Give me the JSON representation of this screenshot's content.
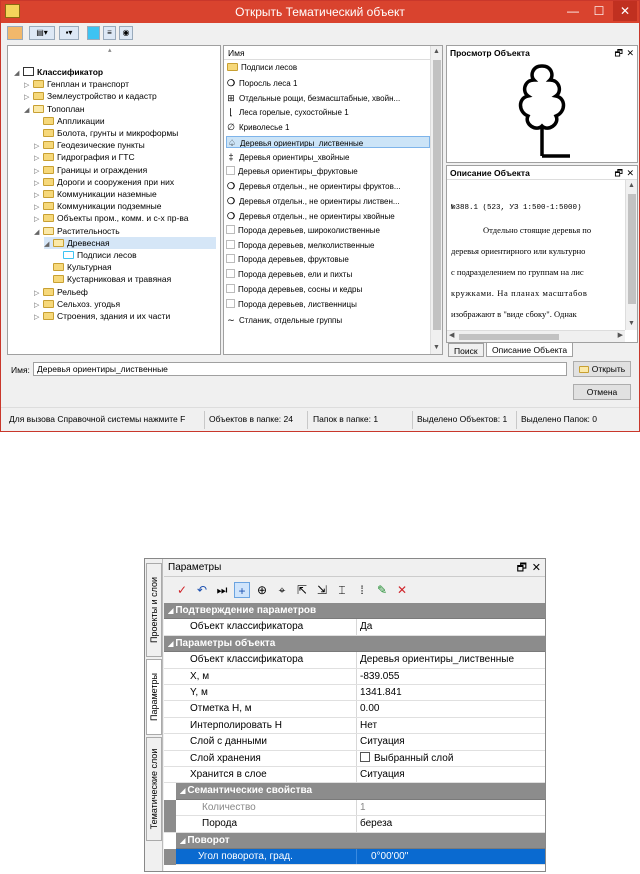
{
  "window": {
    "title": "Открыть Тематический объект",
    "controls": {
      "minimize": "—",
      "maximize": "☐",
      "close": "✕"
    }
  },
  "tree": {
    "items": [
      {
        "label": "Классификатор",
        "level": 0,
        "bold": true
      },
      {
        "label": "Генплан и транспорт",
        "level": 1
      },
      {
        "label": "Землеустройство и кадастр",
        "level": 1
      },
      {
        "label": "Топоплан",
        "level": 1
      },
      {
        "label": "Аппликации",
        "level": 2
      },
      {
        "label": "Болота, грунты и микроформы",
        "level": 2
      },
      {
        "label": "Геодезические пункты",
        "level": 2
      },
      {
        "label": "Гидрография и ГТС",
        "level": 2
      },
      {
        "label": "Границы и ограждения",
        "level": 2
      },
      {
        "label": "Дороги и сооружения при них",
        "level": 2
      },
      {
        "label": "Коммуникации наземные",
        "level": 2
      },
      {
        "label": "Коммуникации подземные",
        "level": 2
      },
      {
        "label": "Объекты пром., комм. и с-х пр-ва",
        "level": 2
      },
      {
        "label": "Растительность",
        "level": 2
      },
      {
        "label": "Древесная",
        "level": 3,
        "selected": true
      },
      {
        "label": "Подписи лесов",
        "level": 4
      },
      {
        "label": "Культурная",
        "level": 3
      },
      {
        "label": "Кустарниковая и травяная",
        "level": 3
      },
      {
        "label": "Рельеф",
        "level": 2
      },
      {
        "label": "Сельхоз. угодья",
        "level": 2
      },
      {
        "label": "Строения, здания и их части",
        "level": 2
      }
    ]
  },
  "list": {
    "header": "Имя",
    "items": [
      {
        "label": "Подписи лесов",
        "icon": "folder-icon"
      },
      {
        "label": "Поросль леса 1",
        "icon": "o"
      },
      {
        "label": "Отдельные рощи, безмасштабные, хвойн...",
        "icon": "tree-grid"
      },
      {
        "label": "Леса горелые, сухостойные 1",
        "icon": "burn"
      },
      {
        "label": "Криволесье 1",
        "icon": "crooked"
      },
      {
        "label": "Деревья ориентиры_лиственные",
        "icon": "tree",
        "selected": true
      },
      {
        "label": "Деревья ориентиры_хвойные",
        "icon": "conifer"
      },
      {
        "label": "Деревья ориентиры_фруктовые",
        "icon": "blank"
      },
      {
        "label": "Деревья отдельн., не ориентиры фруктов...",
        "icon": "o"
      },
      {
        "label": "Деревья отдельн., не ориентиры листвен...",
        "icon": "o"
      },
      {
        "label": "Деревья отдельн., не ориентиры хвойные",
        "icon": "o"
      },
      {
        "label": "Порода деревьев, широколиственные",
        "icon": "blank"
      },
      {
        "label": "Порода деревьев, мелколиственные",
        "icon": "blank"
      },
      {
        "label": "Порода деревьев, фруктовые",
        "icon": "blank"
      },
      {
        "label": "Порода деревьев, ели и пихты",
        "icon": "blank"
      },
      {
        "label": "Порода деревьев, сосны и кедры",
        "icon": "blank"
      },
      {
        "label": "Порода деревьев, лиственницы",
        "icon": "blank"
      },
      {
        "label": "Стланик, отдельные группы",
        "icon": "wave"
      }
    ]
  },
  "preview": {
    "title": "Просмотр Объекта"
  },
  "description": {
    "title": "Описание Объекта",
    "lines": [
      "№388.1 (523, УЗ 1:500-1:5000)",
      "Отдельно стоящие деревья по",
      "деревья ориентирного или культурно",
      "с подразделением по группам на лис",
      "кружками. На планах масштабов",
      "изображают в \"виде сбоку\". Однак"
    ]
  },
  "tabs": {
    "search": "Поиск",
    "description": "Описание Объекта"
  },
  "name_field": {
    "label": "Имя:",
    "value": "Деревья ориентиры_лиственные"
  },
  "buttons": {
    "open": "Открыть",
    "cancel": "Отмена"
  },
  "status": {
    "help": "Для вызова Справочной системы нажмите F",
    "objects": "Объектов в папке: 24",
    "folders": "Папок в папке: 1",
    "sel_objects": "Выделено Объектов: 1",
    "sel_folders": "Выделено Папок: 0"
  },
  "params": {
    "title": "Параметры",
    "vtabs": [
      "Проекты и слои",
      "Параметры",
      "Тематические слои"
    ],
    "rows": [
      {
        "type": "cat",
        "key": "Подтверждение параметров"
      },
      {
        "key": "Объект классификатора",
        "value": "Да"
      },
      {
        "type": "cat",
        "key": "Параметры объекта"
      },
      {
        "key": "Объект классификатора",
        "value": "Деревья ориентиры_лиственные"
      },
      {
        "key": "X, м",
        "value": "-839.055"
      },
      {
        "key": "Y, м",
        "value": "1341.841"
      },
      {
        "key": "Отметка Н, м",
        "value": "0.00"
      },
      {
        "key": "Интерполировать Н",
        "value": "Нет"
      },
      {
        "key": "Слой с данными",
        "value": "Ситуация"
      },
      {
        "key": "Слой хранения",
        "value": "Выбранный слой",
        "checkbox": true
      },
      {
        "key": "Хранится в слое",
        "value": "Ситуация"
      },
      {
        "type": "subcat",
        "key": "Семантические свойства"
      },
      {
        "key": "Количество",
        "value": "1",
        "dim": true,
        "sub": true
      },
      {
        "key": "Порода",
        "value": "береза",
        "sub": true
      },
      {
        "type": "subcat",
        "key": "Поворот"
      },
      {
        "key": "Угол поворота, град.",
        "value": "0°00'00\"",
        "selected": true
      }
    ]
  },
  "colors": {
    "titlebar": "#d9432e",
    "selection": "#0a6ad0",
    "category": "#8c8c8c"
  }
}
